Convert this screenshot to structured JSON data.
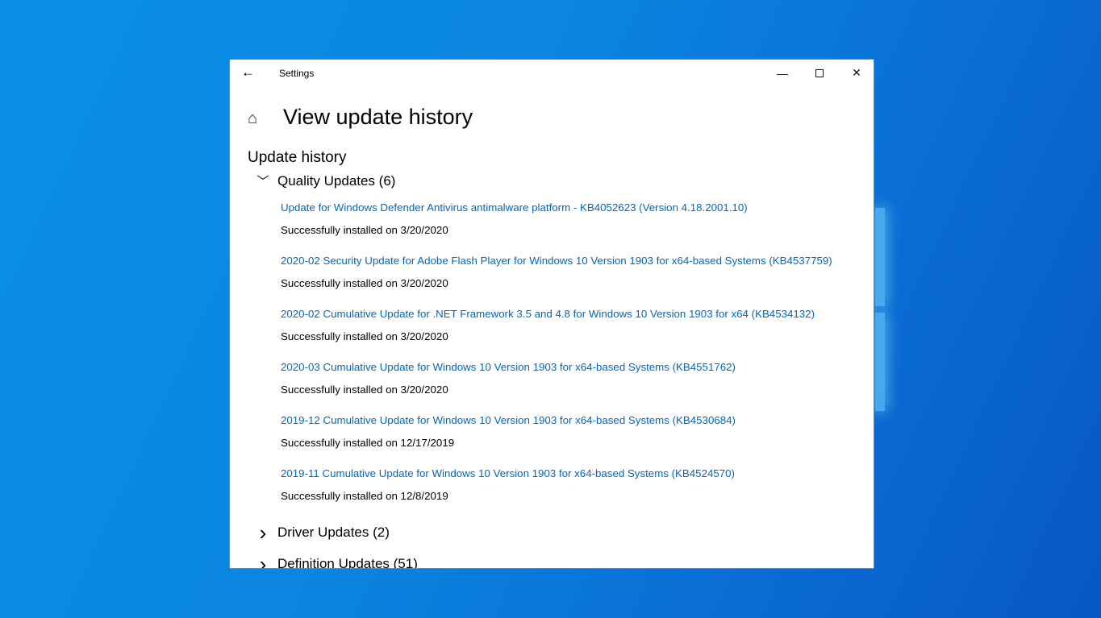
{
  "window": {
    "title": "Settings"
  },
  "page": {
    "title": "View update history",
    "section": "Update history"
  },
  "groups": [
    {
      "label": "Quality Updates (6)",
      "expanded": true
    },
    {
      "label": "Driver Updates (2)",
      "expanded": false
    },
    {
      "label": "Definition Updates (51)",
      "expanded": false
    }
  ],
  "updates": [
    {
      "name": "Update for Windows Defender Antivirus antimalware platform - KB4052623 (Version 4.18.2001.10)",
      "status": "Successfully installed on 3/20/2020"
    },
    {
      "name": "2020-02 Security Update for Adobe Flash Player for Windows 10 Version 1903 for x64-based Systems (KB4537759)",
      "status": "Successfully installed on 3/20/2020"
    },
    {
      "name": "2020-02 Cumulative Update for .NET Framework 3.5 and 4.8 for Windows 10 Version 1903 for x64 (KB4534132)",
      "status": "Successfully installed on 3/20/2020"
    },
    {
      "name": "2020-03 Cumulative Update for Windows 10 Version 1903 for x64-based Systems (KB4551762)",
      "status": "Successfully installed on 3/20/2020"
    },
    {
      "name": "2019-12 Cumulative Update for Windows 10 Version 1903 for x64-based Systems (KB4530684)",
      "status": "Successfully installed on 12/17/2019"
    },
    {
      "name": "2019-11 Cumulative Update for Windows 10 Version 1903 for x64-based Systems (KB4524570)",
      "status": "Successfully installed on 12/8/2019"
    }
  ],
  "colors": {
    "link": "#0067c0",
    "desktop": "#0a86e0"
  }
}
